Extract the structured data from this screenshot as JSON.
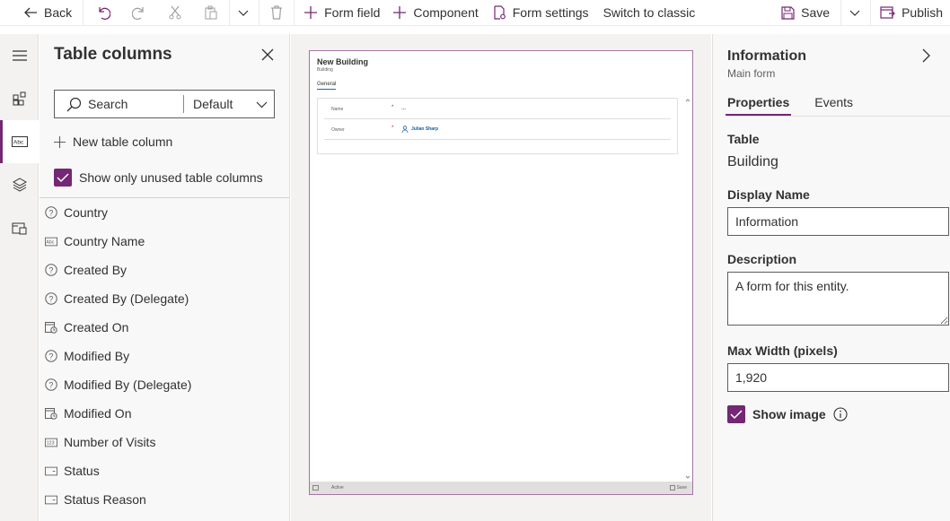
{
  "toolbar": {
    "back_label": "Back",
    "form_field_label": "Form field",
    "component_label": "Component",
    "form_settings_label": "Form settings",
    "switch_classic_label": "Switch to classic",
    "save_label": "Save",
    "publish_label": "Publish"
  },
  "left_panel": {
    "title": "Table columns",
    "search_placeholder": "Search",
    "filter_value": "Default",
    "new_column_label": "New table column",
    "show_unused_label": "Show only unused table columns",
    "show_unused_checked": true,
    "columns": [
      {
        "label": "Country",
        "icon": "option-set-icon"
      },
      {
        "label": "Country Name",
        "icon": "text-icon"
      },
      {
        "label": "Created By",
        "icon": "option-set-icon"
      },
      {
        "label": "Created By (Delegate)",
        "icon": "option-set-icon"
      },
      {
        "label": "Created On",
        "icon": "date-time-icon"
      },
      {
        "label": "Modified By",
        "icon": "option-set-icon"
      },
      {
        "label": "Modified By (Delegate)",
        "icon": "option-set-icon"
      },
      {
        "label": "Modified On",
        "icon": "date-time-icon"
      },
      {
        "label": "Number of Visits",
        "icon": "number-icon"
      },
      {
        "label": "Status",
        "icon": "status-icon"
      },
      {
        "label": "Status Reason",
        "icon": "status-icon"
      }
    ]
  },
  "form_preview": {
    "title": "New Building",
    "subtitle": "Building",
    "tab": "General",
    "fields": [
      {
        "label": "Name",
        "required": "*",
        "value": "---"
      },
      {
        "label": "Owner",
        "required": "*",
        "value": "Julian Sharp"
      }
    ],
    "footer_status": "Active",
    "footer_save": "Save"
  },
  "properties": {
    "title": "Information",
    "subtitle": "Main form",
    "tabs": [
      "Properties",
      "Events"
    ],
    "table_label": "Table",
    "table_value": "Building",
    "display_name_label": "Display Name",
    "display_name_value": "Information",
    "description_label": "Description",
    "description_value": "A form for this entity.",
    "max_width_label": "Max Width (pixels)",
    "max_width_value": "1,920",
    "show_image_label": "Show image",
    "show_image_checked": true
  },
  "colors": {
    "accent": "#742774",
    "link": "#115ea3"
  }
}
